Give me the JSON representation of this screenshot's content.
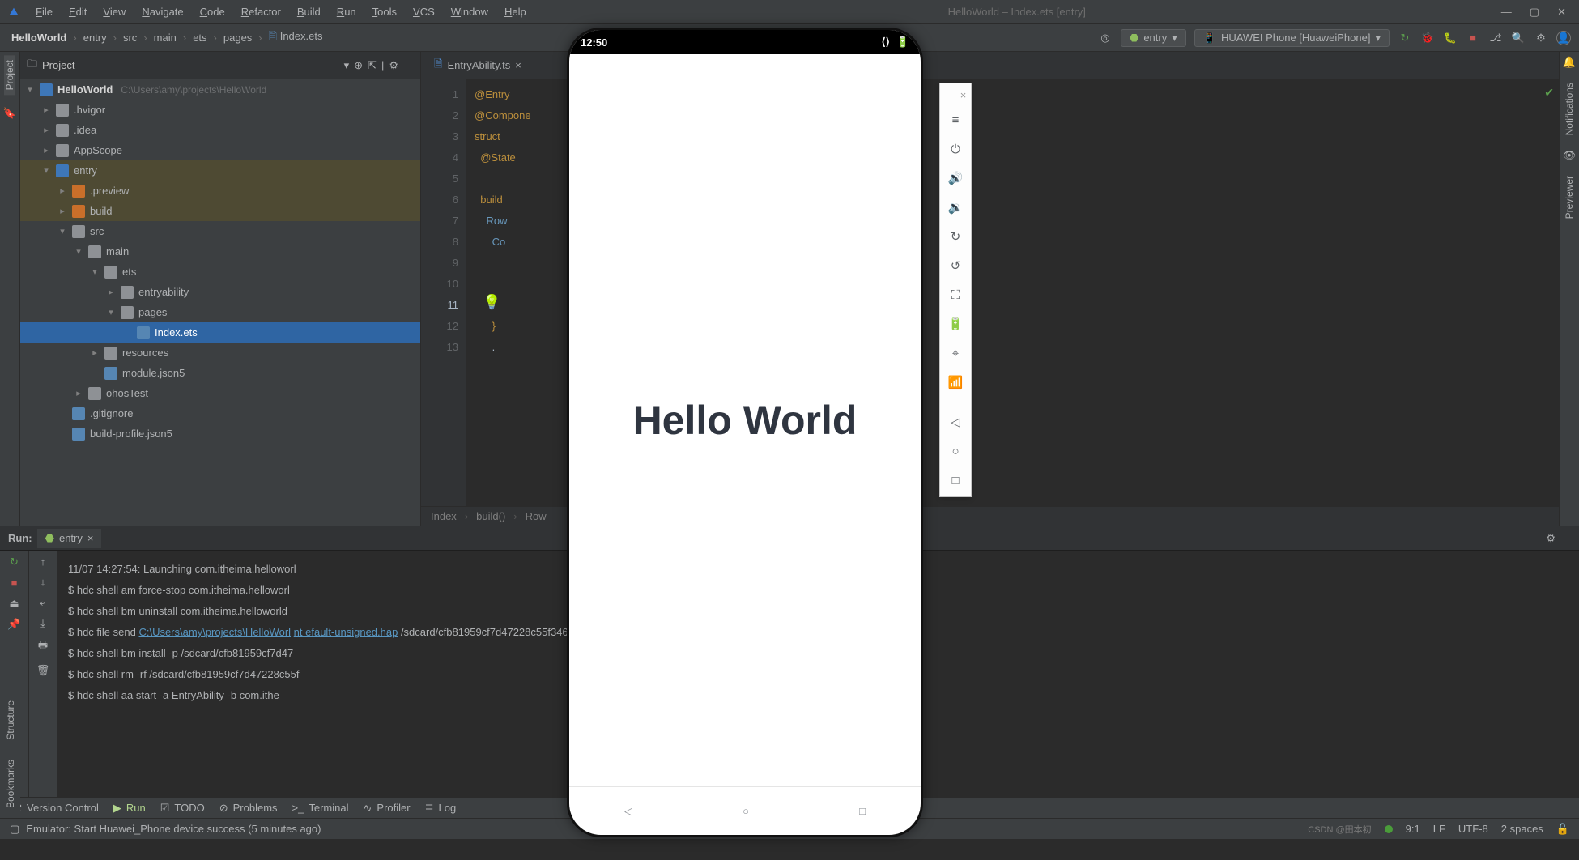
{
  "title": "HelloWorld – Index.ets [entry]",
  "menu": [
    "File",
    "Edit",
    "View",
    "Navigate",
    "Code",
    "Refactor",
    "Build",
    "Run",
    "Tools",
    "VCS",
    "Window",
    "Help"
  ],
  "breadcrumb": [
    "HelloWorld",
    "entry",
    "src",
    "main",
    "ets",
    "pages",
    "Index.ets"
  ],
  "toolbar": {
    "config": "entry",
    "device": "HUAWEI Phone [HuaweiPhone]"
  },
  "project": {
    "title": "Project",
    "root": {
      "name": "HelloWorld",
      "path": "C:\\Users\\amy\\projects\\HelloWorld"
    },
    "items": [
      {
        "d": 1,
        "e": 0,
        "t": "folder",
        "n": ".hvigor"
      },
      {
        "d": 1,
        "e": 0,
        "t": "folder",
        "n": ".idea"
      },
      {
        "d": 1,
        "e": 0,
        "t": "folder",
        "n": "AppScope"
      },
      {
        "d": 1,
        "e": 1,
        "t": "folder-blue",
        "n": "entry",
        "hl": 1
      },
      {
        "d": 2,
        "e": 0,
        "t": "folder-orange",
        "n": ".preview",
        "hl": 1
      },
      {
        "d": 2,
        "e": 0,
        "t": "folder-orange",
        "n": "build",
        "hl": 1
      },
      {
        "d": 2,
        "e": 1,
        "t": "folder",
        "n": "src"
      },
      {
        "d": 3,
        "e": 1,
        "t": "folder",
        "n": "main"
      },
      {
        "d": 4,
        "e": 1,
        "t": "folder",
        "n": "ets"
      },
      {
        "d": 5,
        "e": 0,
        "t": "folder",
        "n": "entryability"
      },
      {
        "d": 5,
        "e": 1,
        "t": "folder",
        "n": "pages"
      },
      {
        "d": 6,
        "e": -1,
        "t": "file",
        "n": "Index.ets",
        "sel": 1
      },
      {
        "d": 4,
        "e": 0,
        "t": "folder",
        "n": "resources"
      },
      {
        "d": 4,
        "e": -1,
        "t": "file",
        "n": "module.json5"
      },
      {
        "d": 3,
        "e": 0,
        "t": "folder",
        "n": "ohosTest"
      },
      {
        "d": 2,
        "e": -1,
        "t": "file",
        "n": ".gitignore"
      },
      {
        "d": 2,
        "e": -1,
        "t": "file",
        "n": "build-profile.json5"
      }
    ]
  },
  "tabs": [
    {
      "name": "EntryAbility.ts",
      "active": false
    },
    {
      "name": "",
      "active": true
    }
  ],
  "code": {
    "lines": [
      {
        "n": 1,
        "html": "<span class='kw-or'>@Entry</span>"
      },
      {
        "n": 2,
        "html": "<span class='kw-or'>@Compone</span>"
      },
      {
        "n": 3,
        "html": "<span class='kw-or'>struct</span> <span class='kw-purple'></span>"
      },
      {
        "n": 4,
        "html": "&nbsp;&nbsp;<span class='kw-or'>@State</span>"
      },
      {
        "n": 5,
        "html": ""
      },
      {
        "n": 6,
        "html": "&nbsp;&nbsp;<span class='kw-or'>build</span>"
      },
      {
        "n": 7,
        "html": "&nbsp;&nbsp;&nbsp;&nbsp;<span class='kw-blue'>Row</span>"
      },
      {
        "n": 8,
        "html": "&nbsp;&nbsp;&nbsp;&nbsp;&nbsp;&nbsp;<span class='kw-blue'>Co</span>"
      },
      {
        "n": 9,
        "html": ""
      },
      {
        "n": 10,
        "html": ""
      },
      {
        "n": 11,
        "html": "",
        "cur": 1
      },
      {
        "n": 12,
        "html": "&nbsp;&nbsp;&nbsp;&nbsp;&nbsp;&nbsp;<span class='kw-or'>}</span>"
      },
      {
        "n": 13,
        "html": "&nbsp;&nbsp;&nbsp;&nbsp;&nbsp;&nbsp;.<span></span>"
      }
    ],
    "breadcrumb": [
      "Index",
      "build()",
      "Row"
    ]
  },
  "run": {
    "label": "Run:",
    "tab": "entry",
    "lines": [
      "11/07 14:27:54: Launching com.itheima.helloworl",
      "$ hdc shell am force-stop com.itheima.helloworl",
      "$ hdc shell bm uninstall com.itheima.helloworld",
      {
        "pre": "$ hdc file send ",
        "link": "C:\\Users\\amy\\projects\\HelloWorl",
        "mid": "                                             ",
        "link2": "nt        efault-unsigned.hap",
        "post": " /sdcard/cfb81959cf7d47228c55f3467c0c"
      },
      "$ hdc shell bm install -p /sdcard/cfb81959cf7d47",
      "$ hdc shell rm -rf /sdcard/cfb81959cf7d47228c55f",
      "$ hdc shell aa start -a EntryAbility -b com.ithe"
    ]
  },
  "bottom": [
    {
      "icon": "⎇",
      "label": "Version Control"
    },
    {
      "icon": "▶",
      "label": "Run",
      "cls": "run"
    },
    {
      "icon": "☑",
      "label": "TODO"
    },
    {
      "icon": "⊘",
      "label": "Problems"
    },
    {
      "icon": ">_",
      "label": "Terminal"
    },
    {
      "icon": "∿",
      "label": "Profiler"
    },
    {
      "icon": "≣",
      "label": "Log"
    }
  ],
  "status": {
    "msg": "Emulator: Start Huawei_Phone device success (5 minutes ago)",
    "pos": "9:1",
    "eol": "LF",
    "enc": "UTF-8",
    "indent": "2 spaces"
  },
  "phone": {
    "time": "12:50",
    "text": "Hello World"
  },
  "em_tools": [
    "—",
    "×",
    "≡",
    "⏻",
    "🔊",
    "🔉",
    "↻",
    "↺",
    "⛶",
    "🔋",
    "⌖",
    "📶"
  ],
  "em_nav": [
    "◁",
    "○",
    "□"
  ],
  "watermark": "CSDN @田本初"
}
